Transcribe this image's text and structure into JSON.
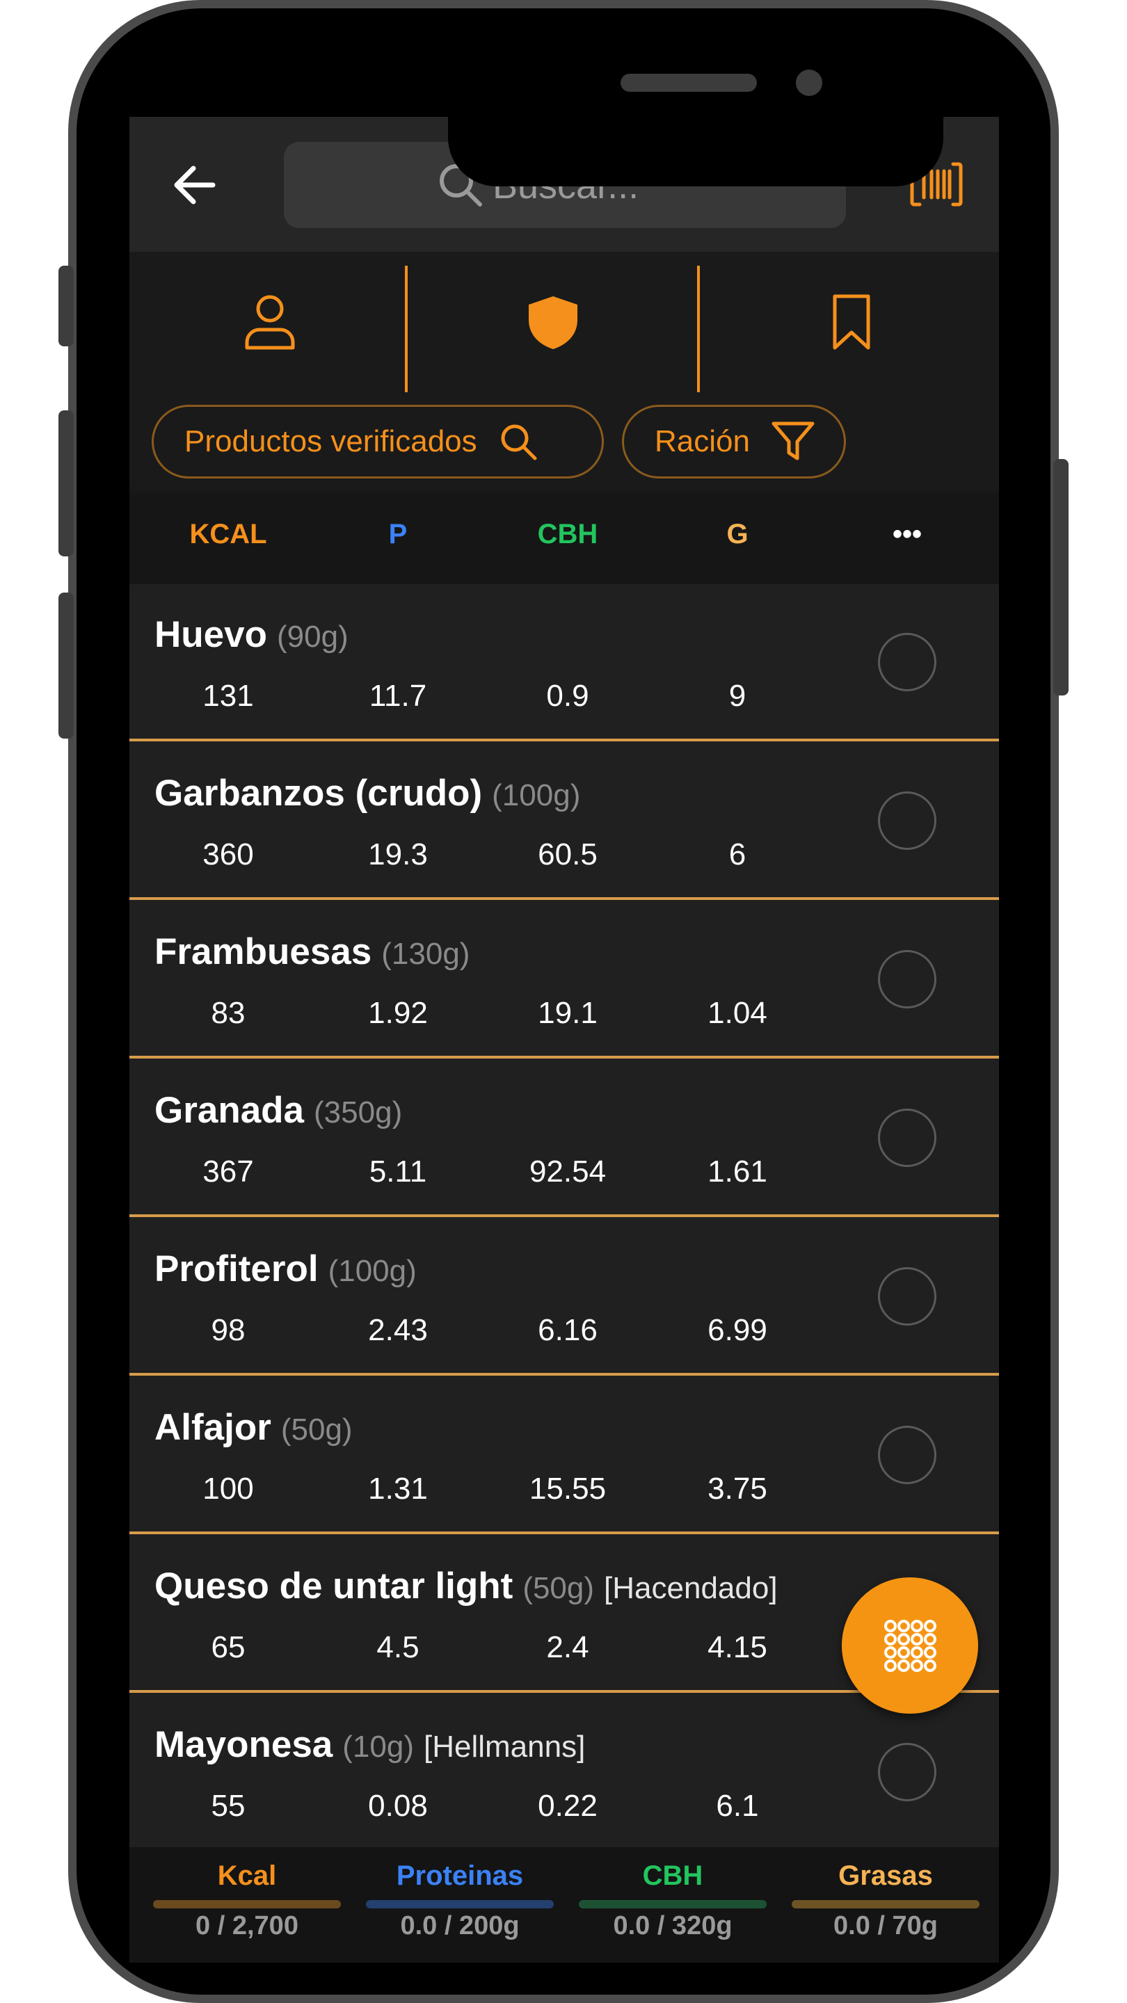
{
  "search": {
    "placeholder": "Buscar..."
  },
  "icons": {
    "back": "arrow-left-icon",
    "search": "search-icon",
    "barcode": "barcode-icon",
    "user": "user-icon",
    "shield": "shield-icon",
    "bookmark": "bookmark-icon",
    "filter": "filter-icon",
    "grid": "grid-dots-icon"
  },
  "chips": {
    "verified": "Productos verificados",
    "portion": "Ración"
  },
  "columns": [
    {
      "label": "KCAL",
      "color": "#f5901c"
    },
    {
      "label": "P",
      "color": "#3b82f6"
    },
    {
      "label": "CBH",
      "color": "#22c55e"
    },
    {
      "label": "G",
      "color": "#f6b354"
    },
    {
      "label": "•••",
      "color": "#ffffff"
    }
  ],
  "foods": [
    {
      "name": "Huevo",
      "portion": "(90g)",
      "brand": "",
      "kcal": "131",
      "p": "11.7",
      "cbh": "0.9",
      "g": "9"
    },
    {
      "name": "Garbanzos (crudo)",
      "portion": "(100g)",
      "brand": "",
      "kcal": "360",
      "p": "19.3",
      "cbh": "60.5",
      "g": "6"
    },
    {
      "name": "Frambuesas",
      "portion": "(130g)",
      "brand": "",
      "kcal": "83",
      "p": "1.92",
      "cbh": "19.1",
      "g": "1.04"
    },
    {
      "name": "Granada",
      "portion": "(350g)",
      "brand": "",
      "kcal": "367",
      "p": "5.11",
      "cbh": "92.54",
      "g": "1.61"
    },
    {
      "name": "Profiterol",
      "portion": "(100g)",
      "brand": "",
      "kcal": "98",
      "p": "2.43",
      "cbh": "6.16",
      "g": "6.99"
    },
    {
      "name": "Alfajor",
      "portion": "(50g)",
      "brand": "",
      "kcal": "100",
      "p": "1.31",
      "cbh": "15.55",
      "g": "3.75"
    },
    {
      "name": "Queso de untar light",
      "portion": "(50g)",
      "brand": "[Hacendado]",
      "kcal": "65",
      "p": "4.5",
      "cbh": "2.4",
      "g": "4.15"
    },
    {
      "name": "Mayonesa",
      "portion": "(10g)",
      "brand": "[Hellmanns]",
      "kcal": "55",
      "p": "0.08",
      "cbh": "0.22",
      "g": "6.1"
    }
  ],
  "totals": [
    {
      "label": "Kcal",
      "value": "0 / 2,700",
      "color": "#f5901c",
      "track": "#6b4a1e"
    },
    {
      "label": "Proteinas",
      "value": "0.0 / 200g",
      "color": "#3b82f6",
      "track": "#23406e"
    },
    {
      "label": "CBH",
      "value": "0.0 / 320g",
      "color": "#22c55e",
      "track": "#1c5233"
    },
    {
      "label": "Grasas",
      "value": "0.0 / 70g",
      "color": "#f6b354",
      "track": "#6e5424"
    }
  ]
}
